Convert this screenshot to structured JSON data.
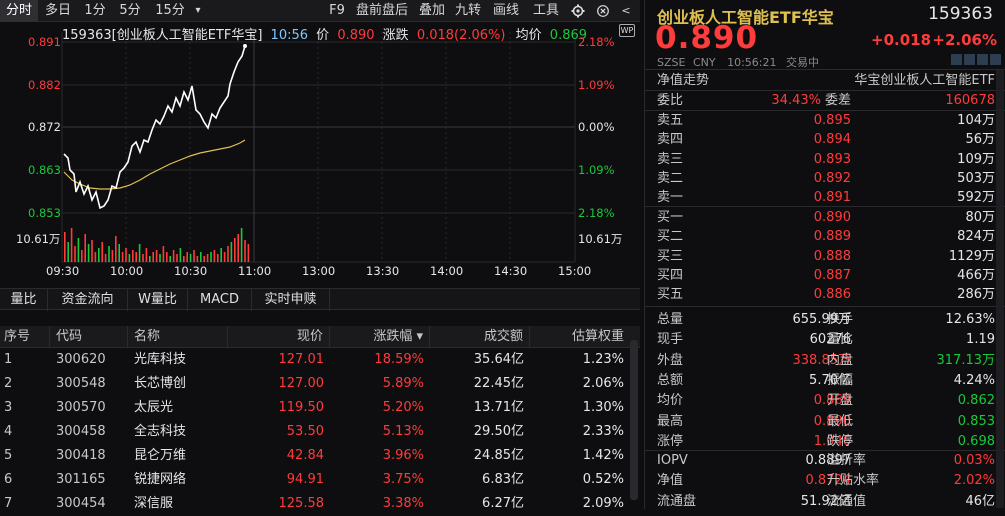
{
  "toolbar": {
    "tabs": [
      "分时",
      "多日",
      "1分",
      "5分",
      "15分",
      "▾"
    ],
    "right": [
      "F9",
      "盘前盘后",
      "叠加",
      "九转",
      "画线",
      "工具"
    ]
  },
  "chart_header": {
    "name": "159363[创业板人工智能ETF华宝]",
    "time": "10:56",
    "price_label": "价",
    "price": "0.890",
    "change_label": "涨跌",
    "change": "0.018(2.06%)",
    "avg_label": "均价",
    "avg": "0.869"
  },
  "y_left": [
    "0.891",
    "0.882",
    "0.872",
    "0.863",
    "0.853",
    "10.61万"
  ],
  "y_right": [
    "2.18%",
    "1.09%",
    "0.00%",
    "1.09%",
    "2.18%",
    "10.61万"
  ],
  "x_axis": [
    "09:30",
    "10:00",
    "10:30",
    "11:00",
    "13:00",
    "13:30",
    "14:00",
    "14:30",
    "15:00"
  ],
  "subtabs": [
    "量比",
    "资金流向",
    "W量比",
    "MACD",
    "实时申赎"
  ],
  "table": {
    "headers": [
      "序号",
      "代码",
      "名称",
      "现价",
      "涨跌幅 ▾",
      "成交额",
      "估算权重"
    ],
    "rows": [
      [
        "1",
        "300620",
        "光库科技",
        "127.01",
        "18.59%",
        "35.64亿",
        "1.23%"
      ],
      [
        "2",
        "300548",
        "长芯博创",
        "127.00",
        "5.89%",
        "22.45亿",
        "2.06%"
      ],
      [
        "3",
        "300570",
        "太辰光",
        "119.50",
        "5.20%",
        "13.71亿",
        "1.30%"
      ],
      [
        "4",
        "300458",
        "全志科技",
        "53.50",
        "5.13%",
        "29.50亿",
        "2.33%"
      ],
      [
        "5",
        "300418",
        "昆仑万维",
        "42.84",
        "3.96%",
        "24.85亿",
        "1.42%"
      ],
      [
        "6",
        "301165",
        "锐捷网络",
        "94.91",
        "3.75%",
        "6.83亿",
        "0.52%"
      ],
      [
        "7",
        "300454",
        "深信服",
        "125.58",
        "3.38%",
        "6.27亿",
        "2.09%"
      ]
    ]
  },
  "quote": {
    "title": "创业板人工智能ETF华宝",
    "code": "159363",
    "price": "0.890",
    "chg": "+0.018",
    "pct": "+2.06%",
    "market": "SZSE",
    "currency": "CNY",
    "time": "10:56:21",
    "status": "交易中",
    "nav_label": "净值走势",
    "nav_name": "华宝创业板人工智能ETF",
    "webi_label": "委比",
    "webi": "34.43%",
    "weicha_label": "委差",
    "weicha": "160678",
    "asks": [
      [
        "卖五",
        "0.895",
        "104万"
      ],
      [
        "卖四",
        "0.894",
        "56万"
      ],
      [
        "卖三",
        "0.893",
        "109万"
      ],
      [
        "卖二",
        "0.892",
        "503万"
      ],
      [
        "卖一",
        "0.891",
        "592万"
      ]
    ],
    "bids": [
      [
        "买一",
        "0.890",
        "80万"
      ],
      [
        "买二",
        "0.889",
        "824万"
      ],
      [
        "买三",
        "0.888",
        "1129万"
      ],
      [
        "买四",
        "0.887",
        "466万"
      ],
      [
        "买五",
        "0.886",
        "286万"
      ]
    ],
    "stats": [
      [
        "总量",
        "655.99万",
        "换手",
        "12.63%"
      ],
      [
        "现手",
        "60276",
        "量比",
        "1.19"
      ],
      [
        "外盘",
        "338.85万",
        "内盘",
        "317.13万"
      ],
      [
        "总额",
        "5.70亿",
        "振幅",
        "4.24%"
      ],
      [
        "均价",
        "0.869",
        "开盘",
        "0.862"
      ],
      [
        "最高",
        "0.890",
        "最低",
        "0.853"
      ],
      [
        "涨停",
        "1.046",
        "跌停",
        "0.698"
      ]
    ],
    "stats2": [
      [
        "IOPV",
        "0.8897",
        "溢折率",
        "0.03%"
      ],
      [
        "净值",
        "0.8724",
        "升贴水率",
        "2.02%"
      ],
      [
        "流通盘",
        "51.92亿",
        "流通值",
        "46亿"
      ]
    ]
  },
  "colors": {
    "up": "#ff3b3b",
    "down": "#19c93b",
    "avg": "#e0c050"
  }
}
